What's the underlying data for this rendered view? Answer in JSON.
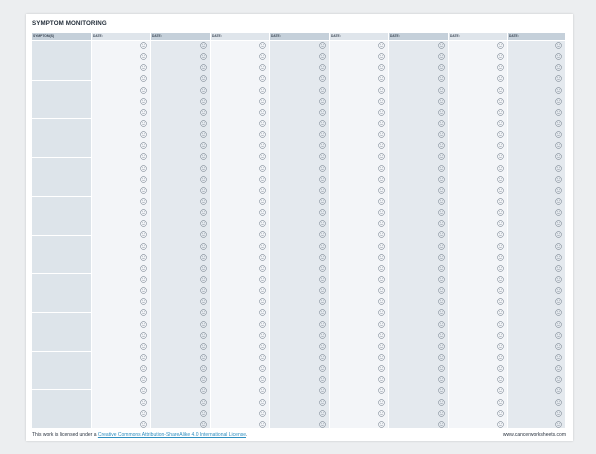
{
  "title": "SYMPTOM MONITORING",
  "symptom_header": "SYMPTOM(S)",
  "date_headers": [
    "DATE:",
    "DATE:",
    "DATE:",
    "DATE:",
    "DATE:",
    "DATE:",
    "DATE:",
    "DATE:"
  ],
  "face_icon": "smiley-face-icon",
  "faces_per_column": 35,
  "symptom_bands": 9,
  "footer": {
    "license_prefix": "This work is licensed under a ",
    "license_link": "Creative Commons Attribution-ShareAlike 4.0 International License",
    "license_suffix": ".",
    "website": "www.cancerworksheets.com"
  },
  "colors": {
    "header_dark": "#c5d0da",
    "header_light": "#dfe5eb",
    "column_light": "#f3f5f8",
    "column_dark": "#e4e9ee",
    "link": "#2f8fc0"
  }
}
